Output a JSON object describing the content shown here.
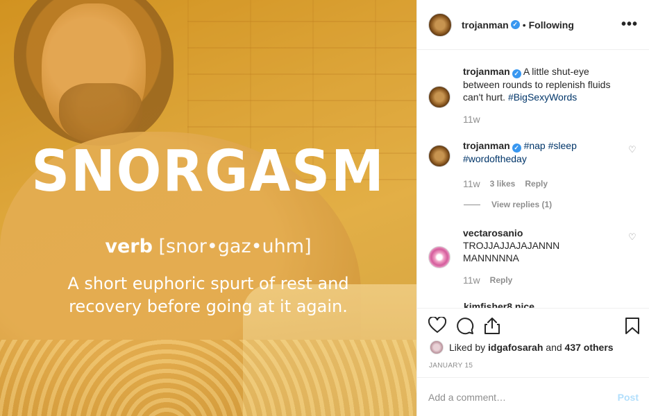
{
  "post": {
    "image": {
      "headword": "SNORGASM",
      "part_of_speech": "verb",
      "pronunciation": "[snor•gaz•uhm]",
      "definition_line1": "A short euphoric spurt of rest and",
      "definition_line2": "recovery before going at it again."
    },
    "header": {
      "username": "trojanman",
      "separator": "•",
      "follow_status": "Following",
      "more_icon": "more-horizontal-icon"
    },
    "caption": {
      "username": "trojanman",
      "text": "A little shut-eye between rounds to replenish fluids can't hurt.",
      "hashtag": "#BigSexyWords",
      "time": "11w"
    },
    "comments": [
      {
        "username": "trojanman",
        "hashtags": [
          "#nap",
          "#sleep",
          "#wordoftheday"
        ],
        "time": "11w",
        "likes": "3 likes",
        "reply": "Reply",
        "view_replies": "View replies (1)"
      },
      {
        "username": "vectarosanio",
        "text_line1": "TROJJAJJAJAJANNN",
        "text_line2": "MANNNNNA",
        "time": "11w",
        "reply": "Reply"
      }
    ],
    "cut_off_comment": "kimfisher8 nice",
    "actions": {
      "icons": [
        "heart-icon",
        "comment-icon",
        "share-icon",
        "bookmark-icon"
      ]
    },
    "likes": {
      "prefix": "Liked by",
      "user": "idgafosarah",
      "joiner": "and",
      "others": "437 others"
    },
    "date": "JANUARY 15",
    "add_comment": {
      "placeholder": "Add a comment…",
      "post_label": "Post"
    },
    "colors": {
      "accent_blue": "#3897f0",
      "hashtag": "#003569",
      "muted": "#8e8e8e",
      "post_disabled": "#b2dffc"
    }
  }
}
